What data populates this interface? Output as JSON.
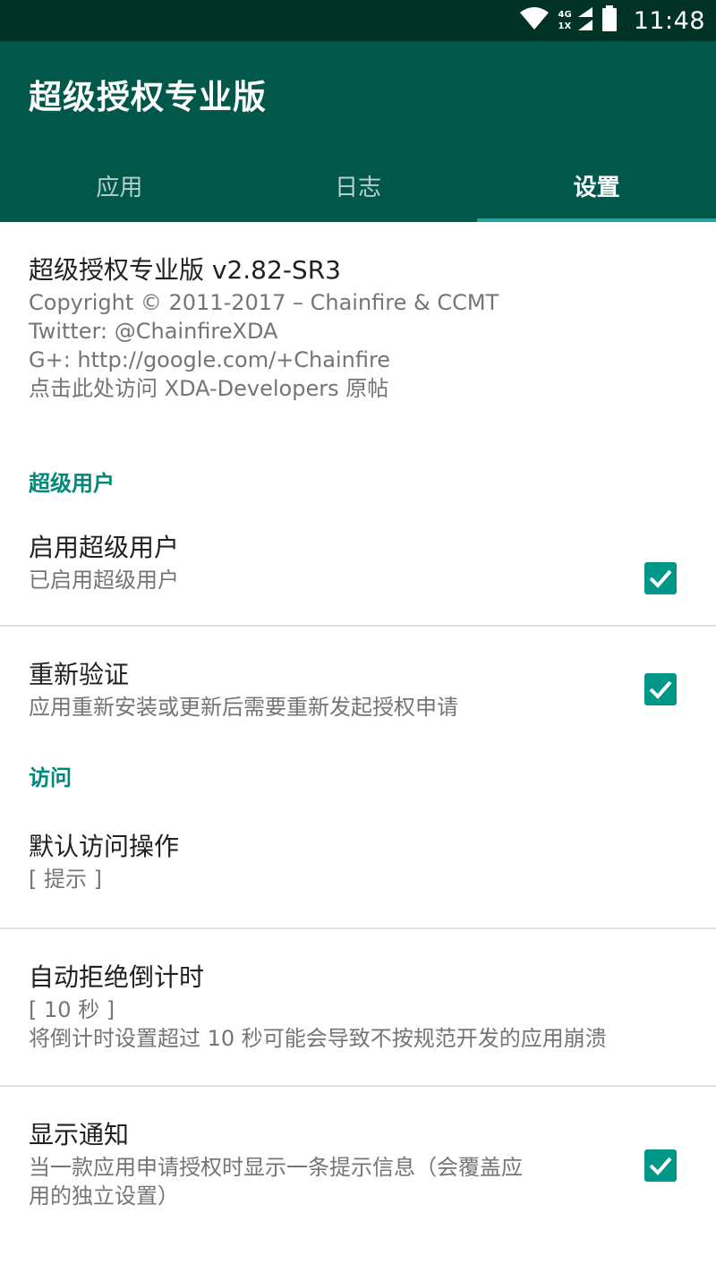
{
  "status_bar": {
    "time": "11:48",
    "network_top": "4G",
    "network_bottom": "1X",
    "icons": [
      "wifi-icon",
      "signal-icon",
      "battery-icon"
    ]
  },
  "app_bar": {
    "title": "超级授权专业版",
    "tabs": [
      {
        "label": "应用",
        "active": false
      },
      {
        "label": "日志",
        "active": false
      },
      {
        "label": "设置",
        "active": true
      }
    ]
  },
  "about": {
    "title": "超级授权专业版 v2.82-SR3",
    "lines": [
      "Copyright © 2011-2017 – Chainfire & CCMT",
      "Twitter: @ChainfireXDA",
      "G+: http://google.com/+Chainfire",
      "点击此处访问 XDA-Developers 原帖"
    ]
  },
  "sections": {
    "superuser": {
      "header": "超级用户",
      "enable": {
        "title": "启用超级用户",
        "summary": "已启用超级用户",
        "checked": true
      },
      "reauth": {
        "title": "重新验证",
        "summary": "应用重新安装或更新后需要重新发起授权申请",
        "checked": true
      }
    },
    "access": {
      "header": "访问",
      "default_action": {
        "title": "默认访问操作",
        "summary": "[ 提示 ]"
      },
      "auto_deny": {
        "title": "自动拒绝倒计时",
        "summary": "[ 10 秒 ]",
        "note": "将倒计时设置超过 10 秒可能会导致不按规范开发的应用崩溃"
      },
      "notifications": {
        "title": "显示通知",
        "summary_line1": "当一款应用申请授权时显示一条提示信息（会覆盖应",
        "summary_line2": "用的独立设置）",
        "checked": true
      }
    }
  },
  "colors": {
    "status_bar": "#003326",
    "app_bar": "#00574a",
    "accent": "#009688",
    "section_header": "#00897b"
  }
}
